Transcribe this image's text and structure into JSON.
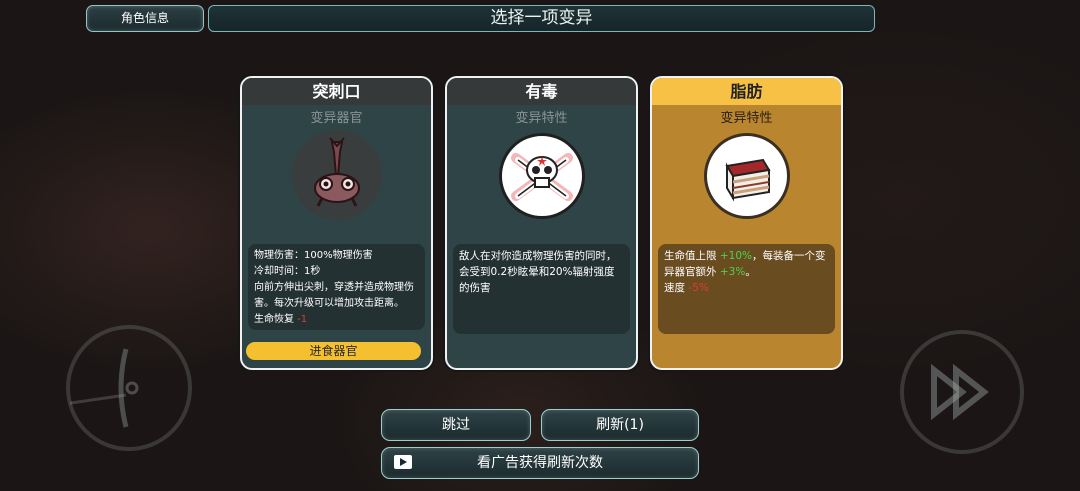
{
  "header": {
    "role_info_label": "角色信息",
    "title": "选择一项变异"
  },
  "cards": [
    {
      "name": "突刺口",
      "type": "变异器官",
      "icon": "thorn-mouth-creature-icon",
      "desc_lines": [
        "物理伤害：100%物理伤害",
        "冷却时间：1秒",
        "向前方伸出尖刺，穿透并造成物理伤",
        "害。每次升级可以增加攻击距离。"
      ],
      "regen_label": "生命恢复",
      "regen_value": "-1",
      "action": "进食器官"
    },
    {
      "name": "有毒",
      "type": "变异特性",
      "icon": "skull-crossbones-icon",
      "desc_lines": [
        "敌人在对你造成物理伤害的同时，",
        "会受到0.2秒眩晕和20%辐射强度",
        "的伤害"
      ]
    },
    {
      "name": "脂肪",
      "type": "变异特性",
      "icon": "fat-meat-block-icon",
      "line1_a": "生命值上限",
      "line1_b": "+10%",
      "line1_c": "，每装备一个变",
      "line2_a": "异器官额外",
      "line2_b": "+3%",
      "line2_c": "。",
      "speed_label": "速度",
      "speed_value": "-5%"
    }
  ],
  "buttons": {
    "skip": "跳过",
    "refresh": "刷新(1)",
    "watch_ad": "看广告获得刷新次数"
  },
  "colors": {
    "selected_card": "#f7c146",
    "accent_border": "#9ad0cc",
    "negative": "#e33b2e",
    "positive": "#4bd44b"
  }
}
